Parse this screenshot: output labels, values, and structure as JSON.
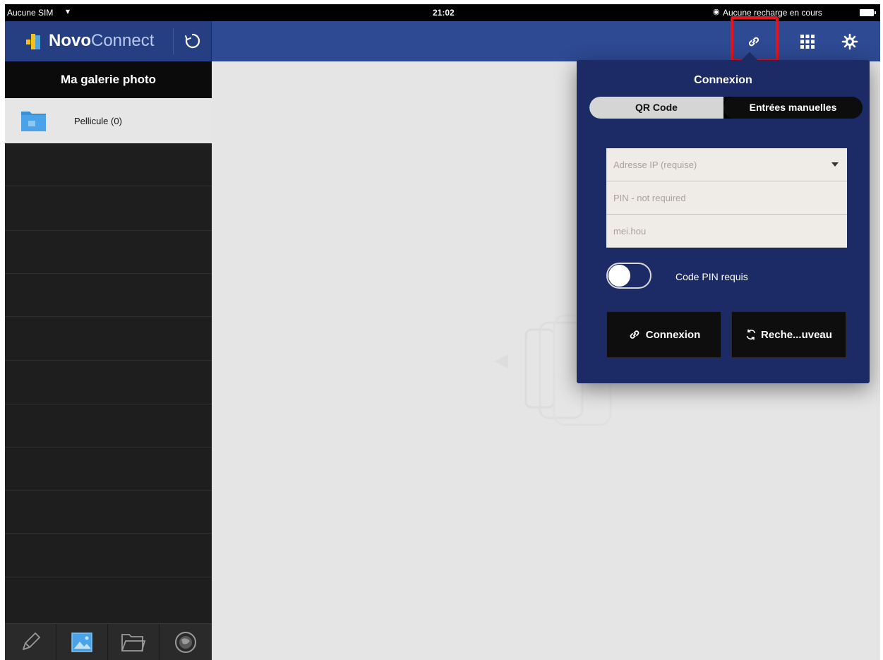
{
  "status_bar": {
    "carrier": "Aucune SIM",
    "time": "21:02",
    "charging": "Aucune recharge en cours"
  },
  "header": {
    "brand_bold": "Novo",
    "brand_light": "Connect",
    "icons": [
      "sync-icon",
      "link-icon",
      "grid-icon",
      "gear-icon"
    ],
    "highlight_color": "#e2151d"
  },
  "sidebar": {
    "title": "Ma galerie photo",
    "albums": [
      {
        "label": "Pellicule (0)",
        "icon": "folder-photo-icon"
      }
    ],
    "tabs": [
      "pencil-icon",
      "photo-icon",
      "folder-icon",
      "globe-icon"
    ],
    "active_tab": 1
  },
  "popover": {
    "title": "Connexion",
    "segments": [
      "QR Code",
      "Entrées manuelles"
    ],
    "selected_segment": 1,
    "fields": {
      "ip_placeholder": "Adresse IP (requise)",
      "pin_placeholder": "PIN - not required",
      "user_value": "mei.hou"
    },
    "pin_toggle_label": "Code PIN requis",
    "pin_toggle_on": false,
    "connect_label": "Connexion",
    "search_label": "Reche...uveau"
  },
  "colors": {
    "header": "#2e4a93",
    "popover": "#1c2a66",
    "sidebar": "#1e1e1e"
  }
}
